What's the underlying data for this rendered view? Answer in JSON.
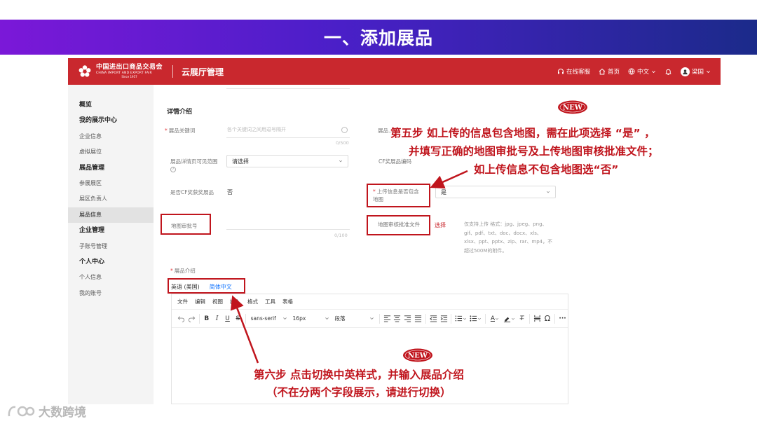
{
  "slide": {
    "title": "一、添加展品"
  },
  "header": {
    "logo_cn": "中国进出口商品交易会",
    "logo_en": "CHINA IMPORT AND EXPORT FAIR",
    "logo_since": "Since 1957",
    "app_title": "云展厅管理",
    "customer_service": "在线客服",
    "home": "首页",
    "language": "中文",
    "user": "梁国"
  },
  "sidebar": {
    "items": [
      {
        "label": "概览",
        "type": "group"
      },
      {
        "label": "我的展示中心",
        "type": "group"
      },
      {
        "label": "企业信息",
        "type": "item"
      },
      {
        "label": "虚拟展位",
        "type": "item"
      },
      {
        "label": "展品管理",
        "type": "group"
      },
      {
        "label": "参展展区",
        "type": "item"
      },
      {
        "label": "展区负责人",
        "type": "item"
      },
      {
        "label": "展品信息",
        "type": "item",
        "active": true
      },
      {
        "label": "企业管理",
        "type": "group"
      },
      {
        "label": "子账号管理",
        "type": "item"
      },
      {
        "label": "个人中心",
        "type": "group"
      },
      {
        "label": "个人信息",
        "type": "item"
      },
      {
        "label": "我的账号",
        "type": "item"
      }
    ]
  },
  "form": {
    "section_title": "详情介绍",
    "keyword_label": "展品关键词",
    "keyword_placeholder": "各个关键词之间用逗号隔开",
    "keyword_counter": "0/500",
    "right_hidden_label": "展品…",
    "visibility_label": "展品详情页可见范围",
    "visibility_value": "请选择",
    "cf_code_label": "CF奖展品编码",
    "cf_award_label": "是否CF奖获奖展品",
    "cf_award_value": "否",
    "map_contains_label": "上传信息是否包含地图",
    "map_contains_value": "是",
    "map_approval_label": "地图审批号",
    "map_approval_counter": "0/100",
    "map_file_label": "地图审核批准文件",
    "map_file_button": "选择",
    "map_file_hint": "仅支持上传 格式：jpg、jpeg、png、gif、pdf、txt、doc、docx、xls、xlsx、ppt、pptx、zip、rar、mp4，不超过500M的附件。",
    "intro_label": "展品介绍"
  },
  "editor": {
    "tabs": [
      {
        "label": "英语 (美国)",
        "active": true
      },
      {
        "label": "简体中文",
        "active": false
      }
    ],
    "menu": [
      "文件",
      "编辑",
      "视图",
      "插入",
      "格式",
      "工具",
      "表格"
    ],
    "font_family": "sans-serif",
    "font_size": "16px",
    "block_format": "段落"
  },
  "annotations": {
    "new_badge": "NEW",
    "step5_lines": [
      "第五步  如上传的信息包含地图，需在此项选择 “是”  ，",
      "并填写正确的地图审批号及上传地图审核批准文件；",
      "如上传信息不包含地图选“否”"
    ],
    "step6_lines": [
      "第六步    点击切换中英样式，并输入展品介绍",
      "（不在分两个字段展示，请进行切换）"
    ]
  },
  "watermark": {
    "text": "大数跨境"
  },
  "colors": {
    "brand_red": "#c9282e",
    "annotation_red": "#c0151d",
    "link_blue": "#1677ff",
    "banner_start": "#7b18d8",
    "banner_end": "#1b2a8a"
  }
}
